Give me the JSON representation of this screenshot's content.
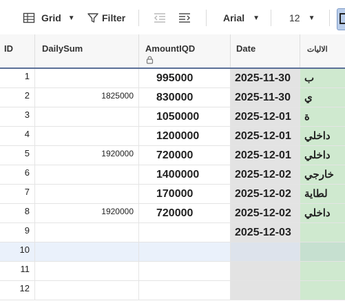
{
  "toolbar": {
    "view_label": "Grid",
    "filter_label": "Filter",
    "font_name": "Arial",
    "font_size": "12"
  },
  "columns": {
    "id": "ID",
    "daily_sum": "DailySum",
    "amount": "AmountIQD",
    "date": "Date",
    "arabic": "الاليات"
  },
  "rows": [
    {
      "id": "1",
      "daily_sum": "",
      "amount": "995000",
      "date": "2025-11-30",
      "arabic": "ب"
    },
    {
      "id": "2",
      "daily_sum": "1825000",
      "amount": "830000",
      "date": "2025-11-30",
      "arabic": "ي"
    },
    {
      "id": "3",
      "daily_sum": "",
      "amount": "1050000",
      "date": "2025-12-01",
      "arabic": "ة"
    },
    {
      "id": "4",
      "daily_sum": "",
      "amount": "1200000",
      "date": "2025-12-01",
      "arabic": "داخلي"
    },
    {
      "id": "5",
      "daily_sum": "1920000",
      "amount": "720000",
      "date": "2025-12-01",
      "arabic": "داخلي"
    },
    {
      "id": "6",
      "daily_sum": "",
      "amount": "1400000",
      "date": "2025-12-02",
      "arabic": "خارجي"
    },
    {
      "id": "7",
      "daily_sum": "",
      "amount": "170000",
      "date": "2025-12-02",
      "arabic": "لطاية"
    },
    {
      "id": "8",
      "daily_sum": "1920000",
      "amount": "720000",
      "date": "2025-12-02",
      "arabic": "داخلي"
    },
    {
      "id": "9",
      "daily_sum": "",
      "amount": "",
      "date": "2025-12-03",
      "arabic": ""
    },
    {
      "id": "10",
      "daily_sum": "",
      "amount": "",
      "date": "",
      "arabic": ""
    },
    {
      "id": "11",
      "daily_sum": "",
      "amount": "",
      "date": "",
      "arabic": ""
    },
    {
      "id": "12",
      "daily_sum": "",
      "amount": "",
      "date": "",
      "arabic": ""
    }
  ],
  "colors": {
    "header_border": "#5a6f97",
    "date_column_bg": "#e3e3e3",
    "arabic_column_bg": "#cfe9cf",
    "selected_row_bg": "#eaf1fb"
  }
}
